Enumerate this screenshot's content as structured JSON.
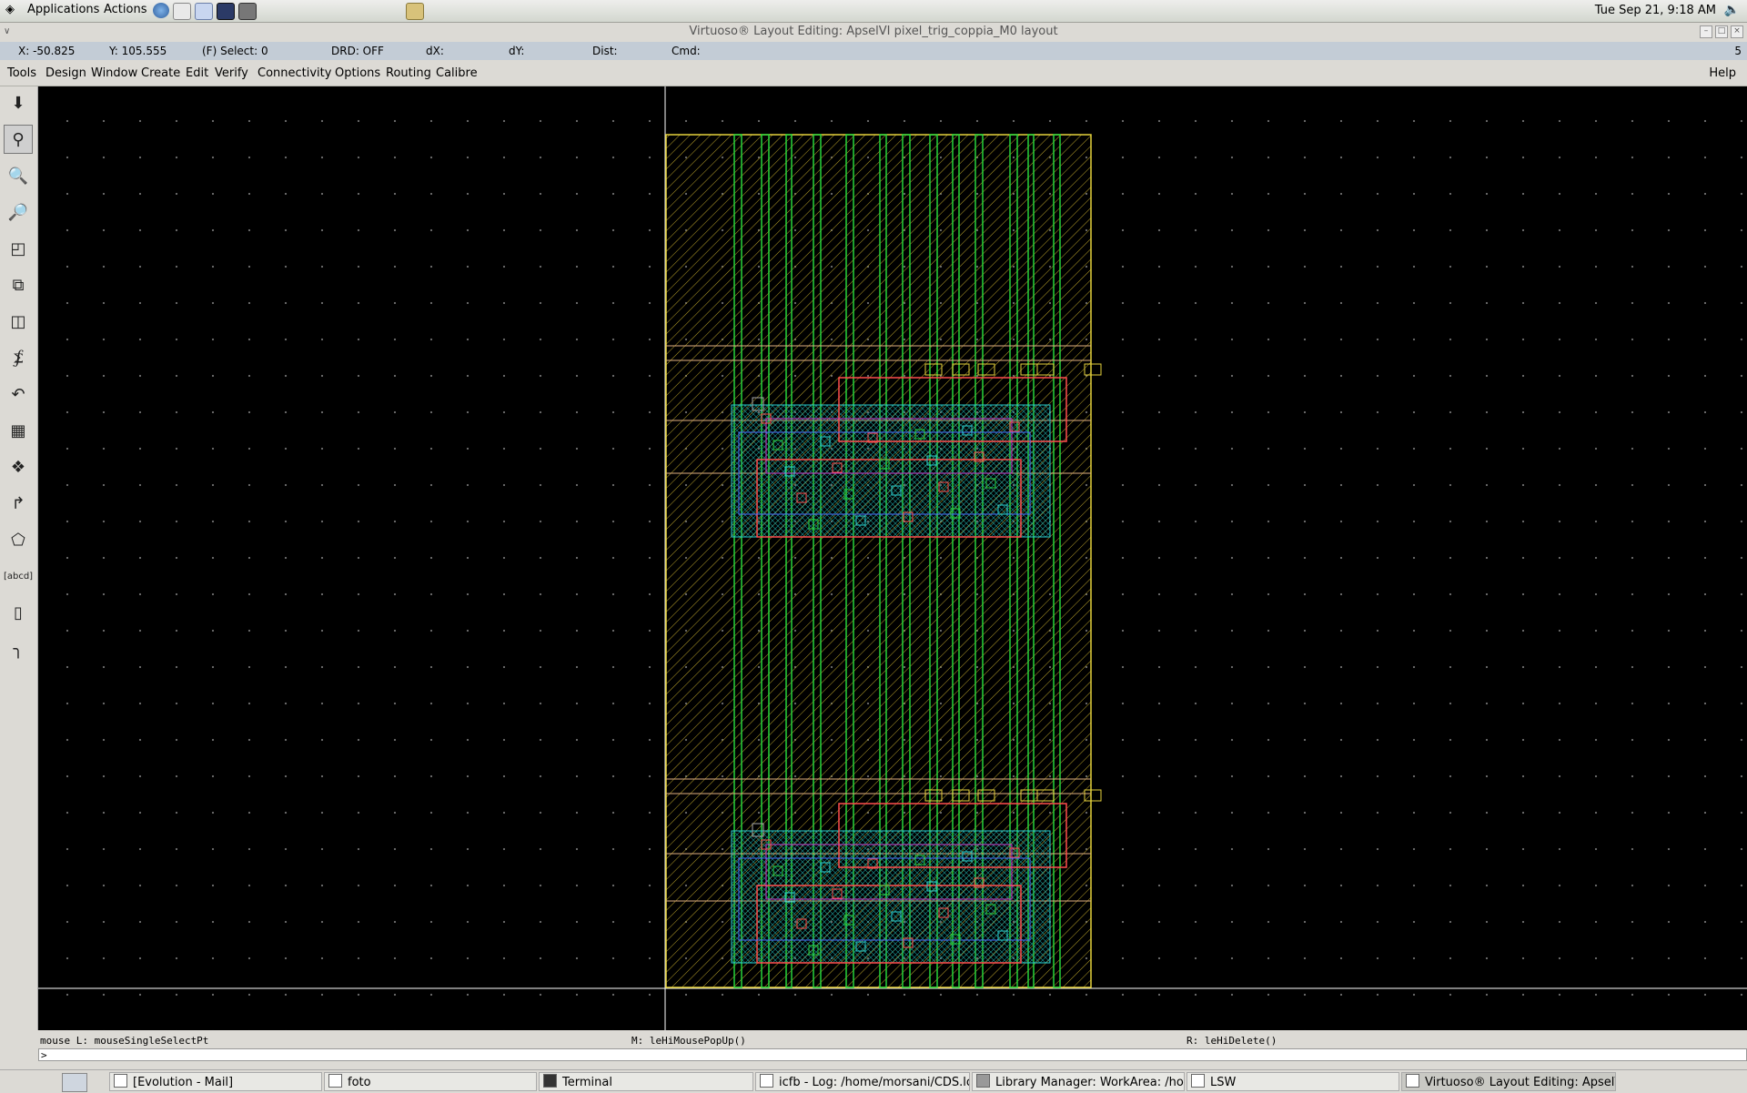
{
  "panel": {
    "applications": "Applications",
    "actions": "Actions",
    "clock": "Tue Sep 21,  9:18 AM",
    "launchers": [
      "globe-icon",
      "mail-icon",
      "editor-icon",
      "terminal-icon",
      "camera-icon",
      "notes-icon"
    ]
  },
  "window": {
    "title": "Virtuoso® Layout Editing: ApselVI pixel_trig_coppia_M0 layout"
  },
  "status": {
    "x": "X: -50.825",
    "y": "Y: 105.555",
    "select": "(F) Select: 0",
    "drd": "DRD: OFF",
    "dx": "dX:",
    "dy": "dY:",
    "dist": "Dist:",
    "cmd": "Cmd:",
    "count": "5"
  },
  "menu": {
    "items": [
      "Tools",
      "Design",
      "Window",
      "Create",
      "Edit",
      "Verify",
      "Connectivity",
      "Options",
      "Routing",
      "Calibre"
    ],
    "help": "Help"
  },
  "toolbar": {
    "tools": [
      "save-icon",
      "zoom-fit-icon",
      "zoom-in-icon",
      "zoom-out-icon",
      "stretch-icon",
      "copy-icon",
      "move-icon",
      "wire-icon",
      "undo-icon",
      "ruler-icon",
      "via-icon",
      "path-icon",
      "polygon-icon",
      "label-icon",
      "rectangle-icon",
      "measure-icon"
    ]
  },
  "mouse": {
    "left": "mouse L: mouseSingleSelectPt",
    "middle": "M: leHiMousePopUp()",
    "right": "R: leHiDelete()"
  },
  "cmdline": {
    "prompt": ">"
  },
  "taskbar": {
    "items": [
      "[Evolution - Mail]",
      "foto",
      "Terminal",
      "icfb - Log: /home/morsani/CDS.lo",
      "Library Manager: WorkArea: /home",
      "LSW",
      "Virtuoso® Layout Editing: ApselVI p"
    ]
  },
  "colors": {
    "canvas": "#000000",
    "boundary": "#e6d23c",
    "metal_green": "#27d43a",
    "poly": "#ff4d4d",
    "diffusion": "#2ad1d1",
    "metal_blue": "#4a6cff",
    "metal_magenta": "#d03dd0",
    "status_bg": "#c3ccd6"
  }
}
